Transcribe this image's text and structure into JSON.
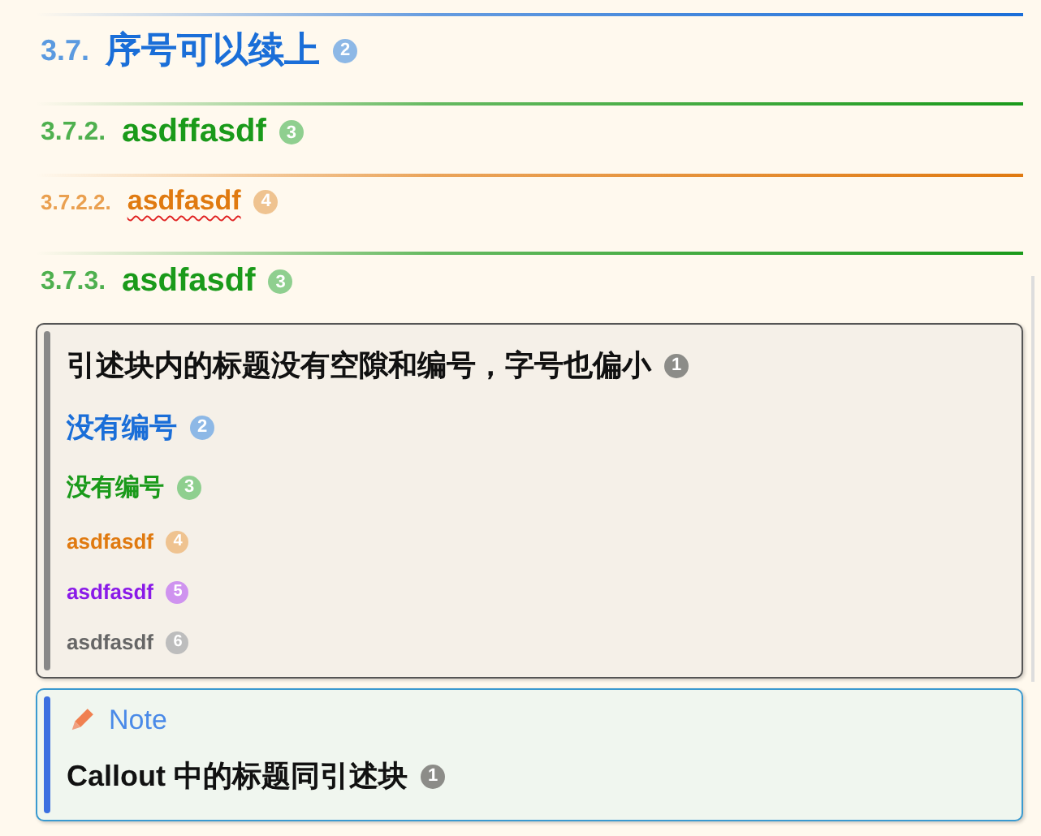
{
  "headings": [
    {
      "number": "3.7.",
      "text": "序号可以续上",
      "kind": "h2",
      "badge": "2",
      "misspelled": false
    },
    {
      "number": "3.7.2.",
      "text": "asdffasdf",
      "kind": "h3",
      "badge": "3",
      "misspelled": false
    },
    {
      "number": "3.7.2.2.",
      "text": "asdfasdf",
      "kind": "h4",
      "badge": "4",
      "misspelled": true
    },
    {
      "number": "3.7.3.",
      "text": "asdfasdf",
      "kind": "h3",
      "badge": "3",
      "misspelled": false
    }
  ],
  "blockquote": {
    "headings": [
      {
        "text": "引述块内的标题没有空隙和编号，字号也偏小",
        "kind": "h1",
        "badge": "1"
      },
      {
        "text": "没有编号",
        "kind": "h2",
        "badge": "2"
      },
      {
        "text": "没有编号",
        "kind": "h3",
        "badge": "3"
      },
      {
        "text": "asdfasdf",
        "kind": "h4",
        "badge": "4"
      },
      {
        "text": "asdfasdf",
        "kind": "h5",
        "badge": "5"
      },
      {
        "text": "asdfasdf",
        "kind": "h6",
        "badge": "6"
      }
    ]
  },
  "callout": {
    "kind": "note",
    "title": "Note",
    "headings": [
      {
        "text": "Callout 中的标题同引述块",
        "kind": "h1",
        "badge": "1"
      }
    ]
  }
}
